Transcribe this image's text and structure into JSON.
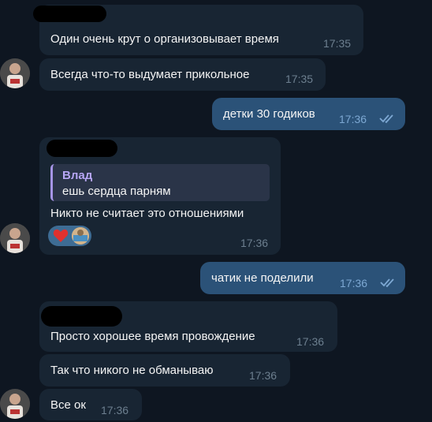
{
  "messages": [
    {
      "text": "Один очень крут о организовывает время",
      "time": "17:35"
    },
    {
      "text": "Всегда что-то выдумает прикольное",
      "time": "17:35"
    },
    {
      "text": "детки 30 годиков",
      "time": "17:36"
    },
    {
      "text": "Никто не считает это отношениями",
      "time": "17:36",
      "reply": {
        "name": "Влад",
        "text": "ешь сердца парням"
      }
    },
    {
      "text": "чатик не поделили",
      "time": "17:36"
    },
    {
      "text": "Просто хорошее время провождение",
      "time": "17:36"
    },
    {
      "text": "Так что никого не обманываю",
      "time": "17:36"
    },
    {
      "text": "Все ок",
      "time": "17:36"
    }
  ],
  "reaction": {
    "emoji": "heart-icon"
  },
  "colors": {
    "background": "#0e1621",
    "incoming": "#182533",
    "outgoing": "#2b5278",
    "reply_accent": "#a695e7"
  }
}
